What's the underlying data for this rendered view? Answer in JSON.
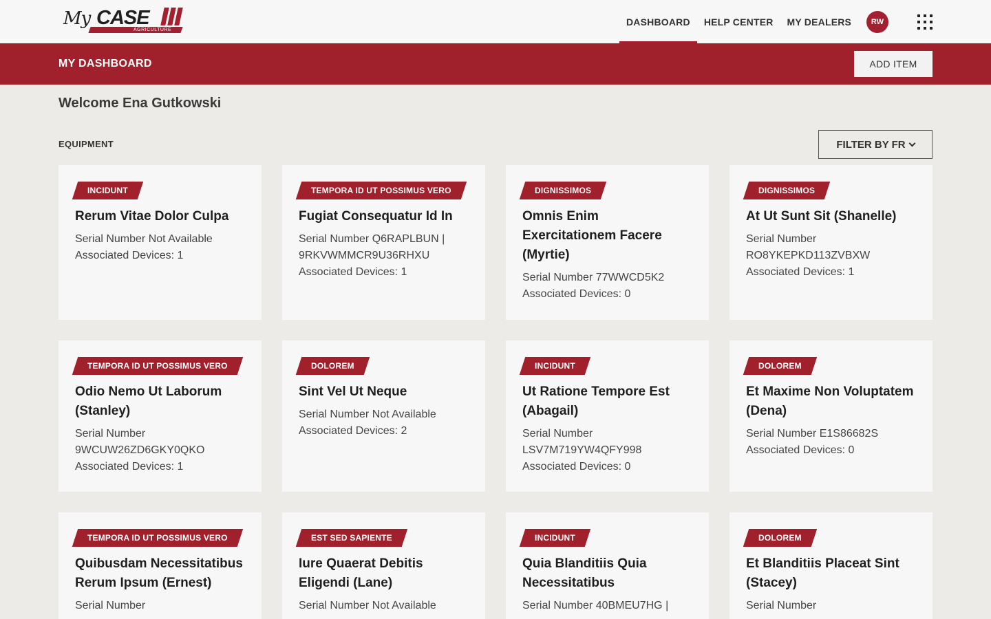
{
  "nav": {
    "logo": {
      "my": "My",
      "case": "CASE",
      "sub": "AGRICULTURE"
    },
    "links": [
      "DASHBOARD",
      "HELP CENTER",
      "MY DEALERS"
    ],
    "avatar_initials": "RW"
  },
  "header": {
    "title": "MY DASHBOARD",
    "add_item": "ADD ITEM"
  },
  "welcome": "Welcome Ena Gutkowski",
  "equipment_label": "EQUIPMENT",
  "filter_label": "FILTER BY FR",
  "colors": {
    "brand_red": "#a0202c",
    "background": "#ecebe8",
    "card": "#f7f7f7"
  },
  "cards": [
    {
      "tag": "INCIDUNT",
      "title": "Rerum Vitae Dolor Culpa",
      "serial": "Serial Number  Not Available",
      "devices": "Associated Devices: 1"
    },
    {
      "tag": "TEMPORA ID UT POSSIMUS VERO",
      "title": "Fugiat Consequatur Id In",
      "serial": "Serial Number  Q6RAPLBUN | 9RKVWMMCR9U36RHXU",
      "devices": "Associated Devices: 1"
    },
    {
      "tag": "DIGNISSIMOS",
      "title": "Omnis Enim Exercitationem Facere (Myrtie)",
      "serial": "Serial Number  77WWCD5K2",
      "devices": "Associated Devices: 0"
    },
    {
      "tag": "DIGNISSIMOS",
      "title": "At Ut Sunt Sit (Shanelle)",
      "serial": "Serial Number RO8YKEPKD113ZVBXW",
      "devices": "Associated Devices: 1"
    },
    {
      "tag": "TEMPORA ID UT POSSIMUS VERO",
      "title": "Odio Nemo Ut Laborum (Stanley)",
      "serial": "Serial Number 9WCUW26ZD6GKY0QKO",
      "devices": "Associated Devices: 1"
    },
    {
      "tag": "DOLOREM",
      "title": "Sint Vel Ut Neque",
      "serial": "Serial Number  Not Available",
      "devices": "Associated Devices: 2"
    },
    {
      "tag": "INCIDUNT",
      "title": "Ut Ratione Tempore Est (Abagail)",
      "serial": "Serial Number LSV7M719YW4QFY998",
      "devices": "Associated Devices: 0"
    },
    {
      "tag": "DOLOREM",
      "title": "Et Maxime Non Voluptatem (Dena)",
      "serial": "Serial Number  E1S86682S",
      "devices": "Associated Devices: 0"
    },
    {
      "tag": "TEMPORA ID UT POSSIMUS VERO",
      "title": "Quibusdam Necessitatibus Rerum Ipsum (Ernest)",
      "serial": "Serial Number",
      "devices": ""
    },
    {
      "tag": "EST SED SAPIENTE",
      "title": "Iure Quaerat Debitis Eligendi (Lane)",
      "serial": "Serial Number  Not Available",
      "devices": ""
    },
    {
      "tag": "INCIDUNT",
      "title": "Quia Blanditiis Quia Necessitatibus",
      "serial": "Serial Number  40BMEU7HG |",
      "devices": ""
    },
    {
      "tag": "DOLOREM",
      "title": "Et Blanditiis Placeat Sint (Stacey)",
      "serial": "Serial Number",
      "devices": ""
    }
  ]
}
